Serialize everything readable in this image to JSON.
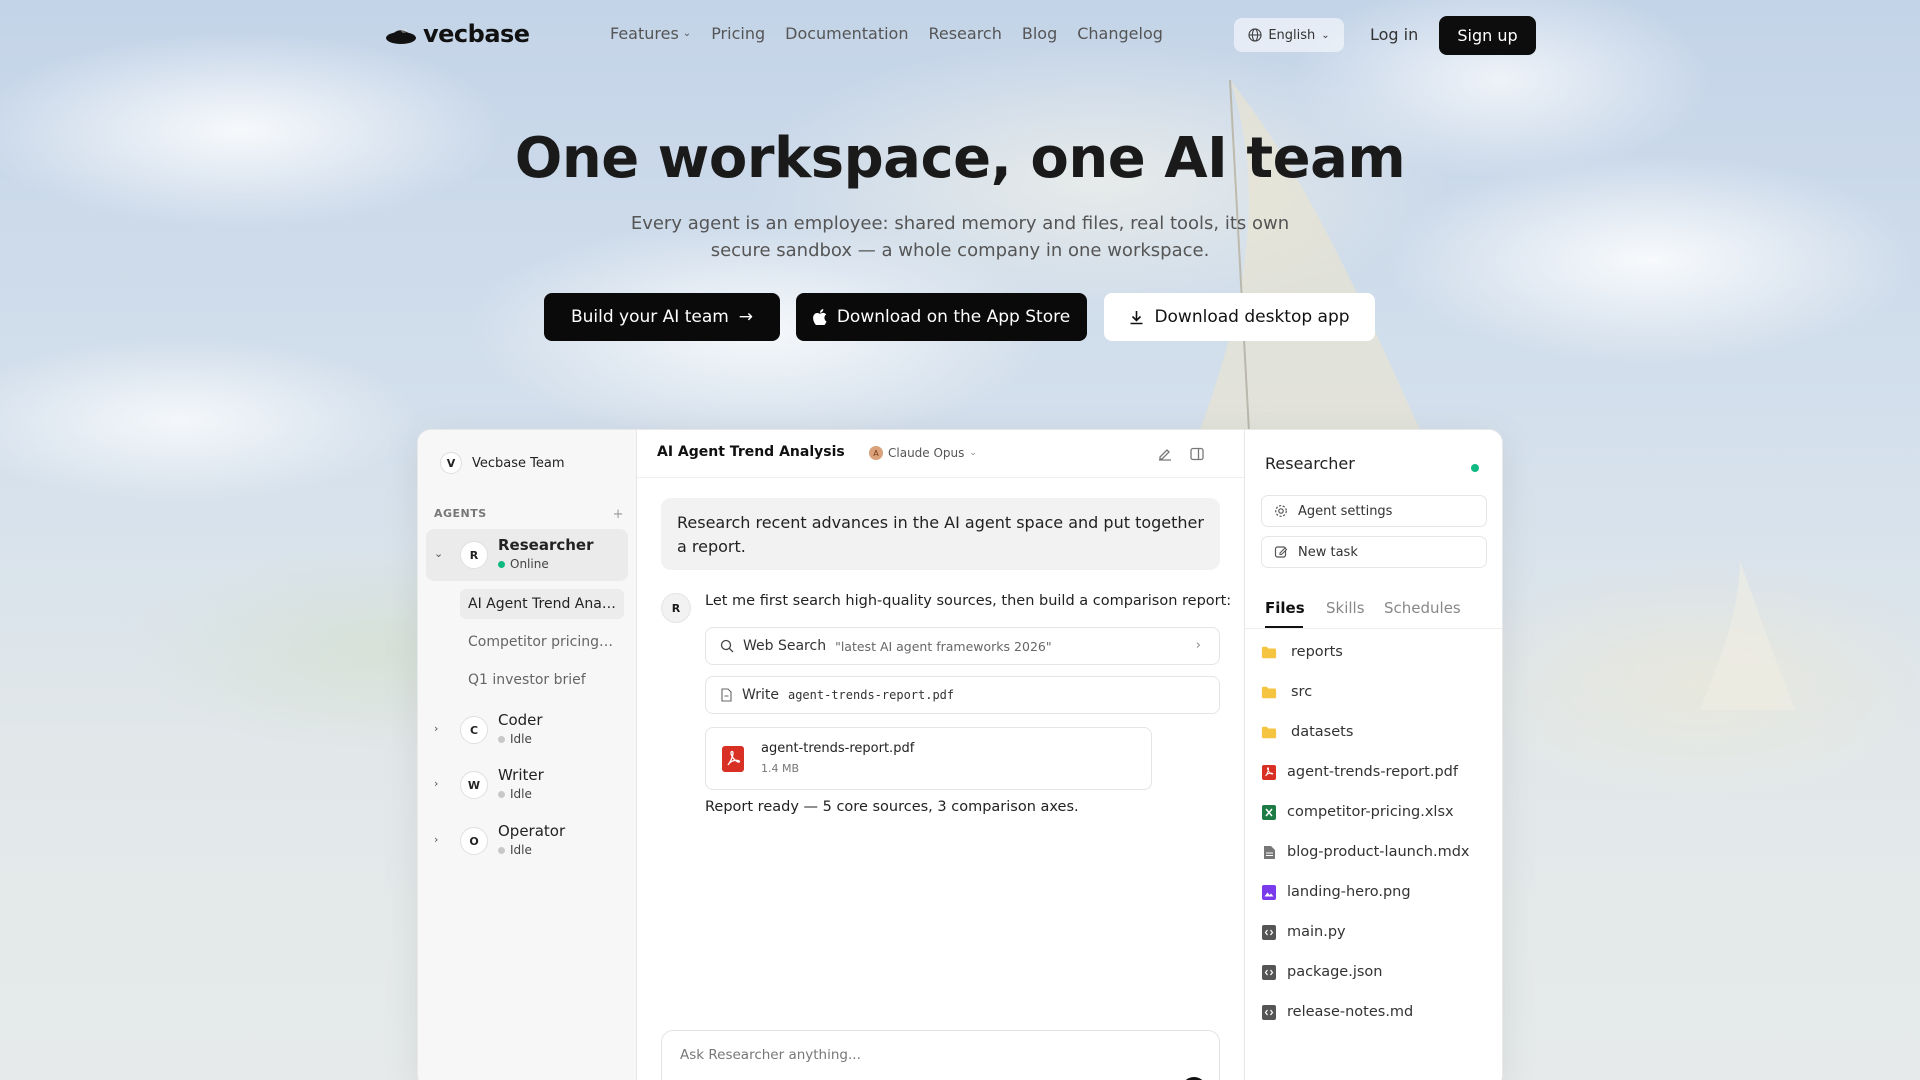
{
  "nav": {
    "logo": "vecbase",
    "links": [
      "Features",
      "Pricing",
      "Documentation",
      "Research",
      "Blog",
      "Changelog"
    ],
    "language": "English",
    "login": "Log in",
    "signup": "Sign up"
  },
  "hero": {
    "title": "One workspace, one AI team",
    "subtitle": "Every agent is an employee: shared memory and files, real tools, its own secure sandbox — a whole company in one workspace.",
    "cta_primary": "Build your AI team",
    "cta_appstore": "Download on the App Store",
    "cta_desktop": "Download desktop app"
  },
  "app": {
    "sidebar": {
      "team_initial": "V",
      "team_name": "Vecbase Team",
      "agents_label": "AGENTS",
      "agents": [
        {
          "initial": "R",
          "name": "Researcher",
          "status": "Online",
          "status_color": "#10b981"
        },
        {
          "initial": "C",
          "name": "Coder",
          "status": "Idle",
          "status_color": "#c8c8c8"
        },
        {
          "initial": "W",
          "name": "Writer",
          "status": "Idle",
          "status_color": "#c8c8c8"
        },
        {
          "initial": "O",
          "name": "Operator",
          "status": "Idle",
          "status_color": "#c8c8c8"
        }
      ],
      "tasks": [
        "AI Agent Trend Analysis",
        "Competitor pricing analysis",
        "Q1 investor brief"
      ]
    },
    "chat": {
      "title": "AI Agent Trend Analysis",
      "model": "Claude Opus",
      "user_message": "Research recent advances in the AI agent space and put together a report.",
      "bot_initial": "R",
      "bot_message": "Let me first search high-quality sources, then build a comparison report:",
      "tool_search_label": "Web Search",
      "tool_search_query": "\"latest AI agent frameworks 2026\"",
      "tool_write_label": "Write",
      "tool_write_file": "agent-trends-report.pdf",
      "file_name": "agent-trends-report.pdf",
      "file_size": "1.4 MB",
      "report_line": "Report ready — 5 core sources, 3 comparison axes.",
      "input_placeholder": "Ask Researcher anything..."
    },
    "panel": {
      "title": "Researcher",
      "agent_settings": "Agent settings",
      "new_task": "New task",
      "tabs": [
        "Files",
        "Skills",
        "Schedules"
      ],
      "files": [
        {
          "name": "reports",
          "icon": "folder-icon",
          "color": "#f5c542"
        },
        {
          "name": "src",
          "icon": "folder-icon",
          "color": "#f5c542"
        },
        {
          "name": "datasets",
          "icon": "folder-icon",
          "color": "#f5c542"
        },
        {
          "name": "agent-trends-report.pdf",
          "icon": "pdf-icon",
          "color": "#d93025"
        },
        {
          "name": "competitor-pricing.xlsx",
          "icon": "excel-icon",
          "color": "#1e7b45"
        },
        {
          "name": "blog-product-launch.mdx",
          "icon": "document-icon",
          "color": "#777777"
        },
        {
          "name": "landing-hero.png",
          "icon": "image-icon",
          "color": "#7c3aed"
        },
        {
          "name": "main.py",
          "icon": "code-icon",
          "color": "#555555"
        },
        {
          "name": "package.json",
          "icon": "code-icon",
          "color": "#555555"
        },
        {
          "name": "release-notes.md",
          "icon": "code-icon",
          "color": "#555555"
        }
      ]
    }
  }
}
